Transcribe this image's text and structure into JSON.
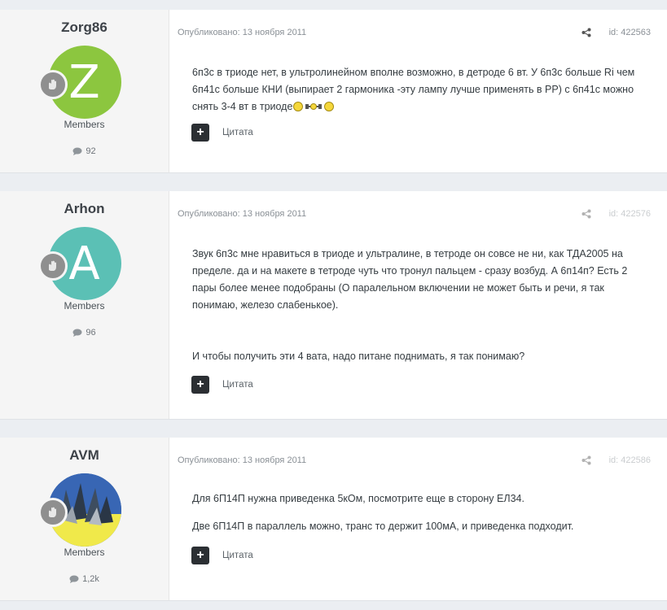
{
  "posts": [
    {
      "author": "Zorg86",
      "avatar_letter": "Z",
      "avatar_color": "#8cc63f",
      "group": "Members",
      "post_count": "92",
      "published": "Опубликовано: 13 ноября 2011",
      "post_id": "id: 422563",
      "paragraphs": [
        "6п3с в триоде нет, в ультролинейном вполне возможно, в детроде 6 вт. У 6п3с больше Ri чем 6п41с больше КНИ (выпирает 2 гармоника -эту лампу лучше применять в РР) с 6п41с можно снять 3-4 вт в триоде"
      ],
      "quote_label": "Цитата"
    },
    {
      "author": "Arhon",
      "avatar_letter": "A",
      "avatar_color": "#5bc0b5",
      "group": "Members",
      "post_count": "96",
      "published": "Опубликовано: 13 ноября 2011",
      "post_id": "id: 422576",
      "paragraphs": [
        "Звук 6п3с мне нравиться в триоде и ультралине, в тетроде он совсе не ни, как ТДА2005 на пределе. да и на макете в тетроде чуть что тронул пальцем - сразу возбуд. А 6п14п? Есть 2 пары более менее подобраны (О паралельном включении не может быть и речи, я так понимаю, железо слабенькое).",
        "И чтобы получить эти 4 вата, надо питане поднимать, я так понимаю?"
      ],
      "quote_label": "Цитата"
    },
    {
      "author": "AVM",
      "avatar_color": "#2f5ea8",
      "group": "Members",
      "post_count": "1,2k",
      "published": "Опубликовано: 13 ноября 2011",
      "post_id": "id: 422586",
      "paragraphs": [
        "Для 6П14П нужна приведенка 5кОм, посмотрите еще в сторону ЕЛ34.",
        "Две 6П14П в параллель можно, транс то держит 100мА, и приведенка подходит."
      ],
      "quote_label": "Цитата"
    }
  ]
}
